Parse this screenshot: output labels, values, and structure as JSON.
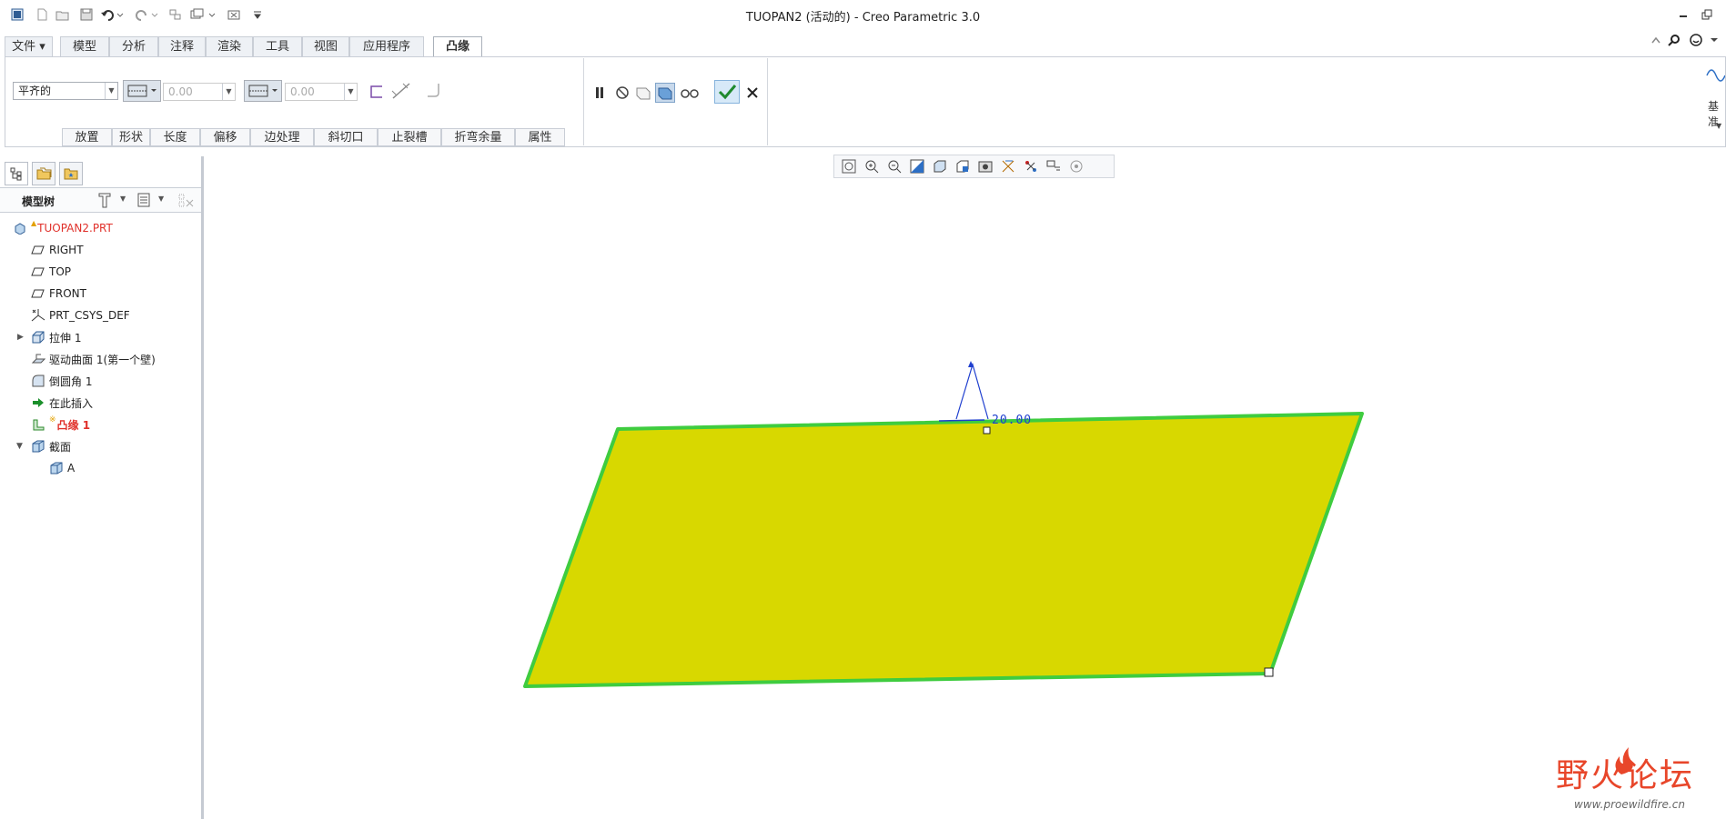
{
  "window": {
    "title": "TUOPAN2 (活动的) - Creo Parametric 3.0"
  },
  "quick_access": [
    "window-icon",
    "new-icon",
    "open-icon",
    "save-icon",
    "undo-icon",
    "redo-icon",
    "regenerate-icon",
    "windows-icon",
    "close-window-icon",
    "customize-icon"
  ],
  "ribbon_tabs": [
    {
      "label": "文件"
    },
    {
      "label": "模型"
    },
    {
      "label": "分析"
    },
    {
      "label": "注释"
    },
    {
      "label": "渲染"
    },
    {
      "label": "工具"
    },
    {
      "label": "视图"
    },
    {
      "label": "应用程序"
    },
    {
      "label": "凸缘"
    }
  ],
  "ribbon": {
    "shape_select": "平齐的",
    "length1_value": "0.00",
    "length2_value": "0.00",
    "sub_tabs": [
      "放置",
      "形状",
      "长度",
      "偏移",
      "边处理",
      "斜切口",
      "止裂槽",
      "折弯余量",
      "属性"
    ],
    "right_group_label": "基准"
  },
  "model_tree": {
    "header": "模型树",
    "items": [
      {
        "label": "TUOPAN2.PRT",
        "icon": "part-icon",
        "color": "#e0302a"
      },
      {
        "label": "RIGHT",
        "icon": "datum-plane-icon"
      },
      {
        "label": "TOP",
        "icon": "datum-plane-icon"
      },
      {
        "label": "FRONT",
        "icon": "datum-plane-icon"
      },
      {
        "label": "PRT_CSYS_DEF",
        "icon": "csys-icon"
      },
      {
        "label": "拉伸 1",
        "icon": "extrude-icon"
      },
      {
        "label": "驱动曲面 1(第一个壁)",
        "icon": "driving-surface-icon"
      },
      {
        "label": "倒圆角 1",
        "icon": "round-icon"
      },
      {
        "label": "在此插入",
        "icon": "insert-here-icon"
      },
      {
        "label": "凸缘 1",
        "icon": "flange-icon",
        "color": "#e0302a"
      },
      {
        "label": "截面",
        "icon": "section-icon"
      },
      {
        "label": "A",
        "icon": "section-item-icon"
      }
    ]
  },
  "graphics": {
    "dimension_label": "20.00",
    "surface_color": "#d8d800",
    "edge_color": "#3fcc3f"
  },
  "watermark": {
    "text": "野火论坛",
    "url": "www.proewildfire.cn"
  }
}
